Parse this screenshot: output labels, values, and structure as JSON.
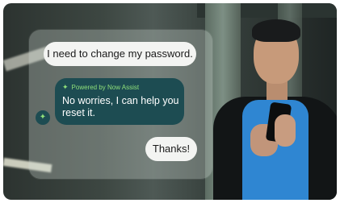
{
  "chat": {
    "user_message": "I need to change my password.",
    "assistant": {
      "powered_by": "Powered by Now Assist",
      "message": "No worries, I can help you reset it."
    },
    "user_reply": "Thanks!"
  },
  "icons": {
    "assistant_avatar": "sparkle-icon",
    "powered_by_icon": "sparkle-icon"
  },
  "colors": {
    "assistant_bubble": "#1d4c52",
    "accent_green": "#8fe07a",
    "user_bubble": "#f3f4f2"
  }
}
